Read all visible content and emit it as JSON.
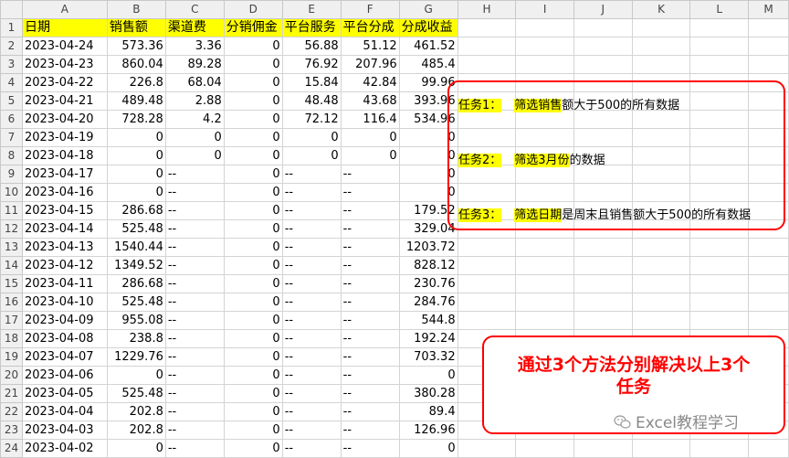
{
  "columns": [
    "A",
    "B",
    "C",
    "D",
    "E",
    "F",
    "G",
    "H",
    "I",
    "J",
    "K",
    "L",
    "M"
  ],
  "headers": [
    "日期",
    "销售额",
    "渠道费",
    "分销佣金",
    "平台服务",
    "平台分成",
    "分成收益"
  ],
  "rows": [
    [
      "2023-04-24",
      "573.36",
      "3.36",
      "0",
      "56.88",
      "51.12",
      "461.52"
    ],
    [
      "2023-04-23",
      "860.04",
      "89.28",
      "0",
      "76.92",
      "207.96",
      "485.4"
    ],
    [
      "2023-04-22",
      "226.8",
      "68.04",
      "0",
      "15.84",
      "42.84",
      "99.96"
    ],
    [
      "2023-04-21",
      "489.48",
      "2.88",
      "0",
      "48.48",
      "43.68",
      "393.96"
    ],
    [
      "2023-04-20",
      "728.28",
      "4.2",
      "0",
      "72.12",
      "116.4",
      "534.96"
    ],
    [
      "2023-04-19",
      "0",
      "0",
      "0",
      "0",
      "0",
      "0"
    ],
    [
      "2023-04-18",
      "0",
      "0",
      "0",
      "0",
      "0",
      "0"
    ],
    [
      "2023-04-17",
      "0",
      "--",
      "0",
      "--",
      "--",
      "0"
    ],
    [
      "2023-04-16",
      "0",
      "--",
      "0",
      "--",
      "--",
      "0"
    ],
    [
      "2023-04-15",
      "286.68",
      "--",
      "0",
      "--",
      "--",
      "179.52"
    ],
    [
      "2023-04-14",
      "525.48",
      "--",
      "0",
      "--",
      "--",
      "329.04"
    ],
    [
      "2023-04-13",
      "1540.44",
      "--",
      "0",
      "--",
      "--",
      "1203.72"
    ],
    [
      "2023-04-12",
      "1349.52",
      "--",
      "0",
      "--",
      "--",
      "828.12"
    ],
    [
      "2023-04-11",
      "286.68",
      "--",
      "0",
      "--",
      "--",
      "230.76"
    ],
    [
      "2023-04-10",
      "525.48",
      "--",
      "0",
      "--",
      "--",
      "284.76"
    ],
    [
      "2023-04-09",
      "955.08",
      "--",
      "0",
      "--",
      "--",
      "544.8"
    ],
    [
      "2023-04-08",
      "238.8",
      "--",
      "0",
      "--",
      "--",
      "192.24"
    ],
    [
      "2023-04-07",
      "1229.76",
      "--",
      "0",
      "--",
      "--",
      "703.32"
    ],
    [
      "2023-04-06",
      "0",
      "--",
      "0",
      "--",
      "--",
      "0"
    ],
    [
      "2023-04-05",
      "525.48",
      "--",
      "0",
      "--",
      "--",
      "380.28"
    ],
    [
      "2023-04-04",
      "202.8",
      "--",
      "0",
      "--",
      "--",
      "89.4"
    ],
    [
      "2023-04-03",
      "202.8",
      "--",
      "0",
      "--",
      "--",
      "126.96"
    ],
    [
      "2023-04-02",
      "0",
      "--",
      "0",
      "--",
      "--",
      "0"
    ]
  ],
  "tasks": [
    {
      "label": "任务1：",
      "sp": "筛选销售",
      "rest": "额大于500的所有数据"
    },
    {
      "label": "任务2：",
      "sp": "筛选3月份",
      "rest": "的数据"
    },
    {
      "label": "任务3：",
      "sp": "筛选日期",
      "rest": "是周末且销售额大于500的所有数据"
    }
  ],
  "message": {
    "line1": "通过3个方法分别解决以上3个",
    "line2": "任务"
  },
  "watermark": "Excel教程学习",
  "colors": {
    "highlight": "#ffff00",
    "accent": "#ff0000"
  }
}
